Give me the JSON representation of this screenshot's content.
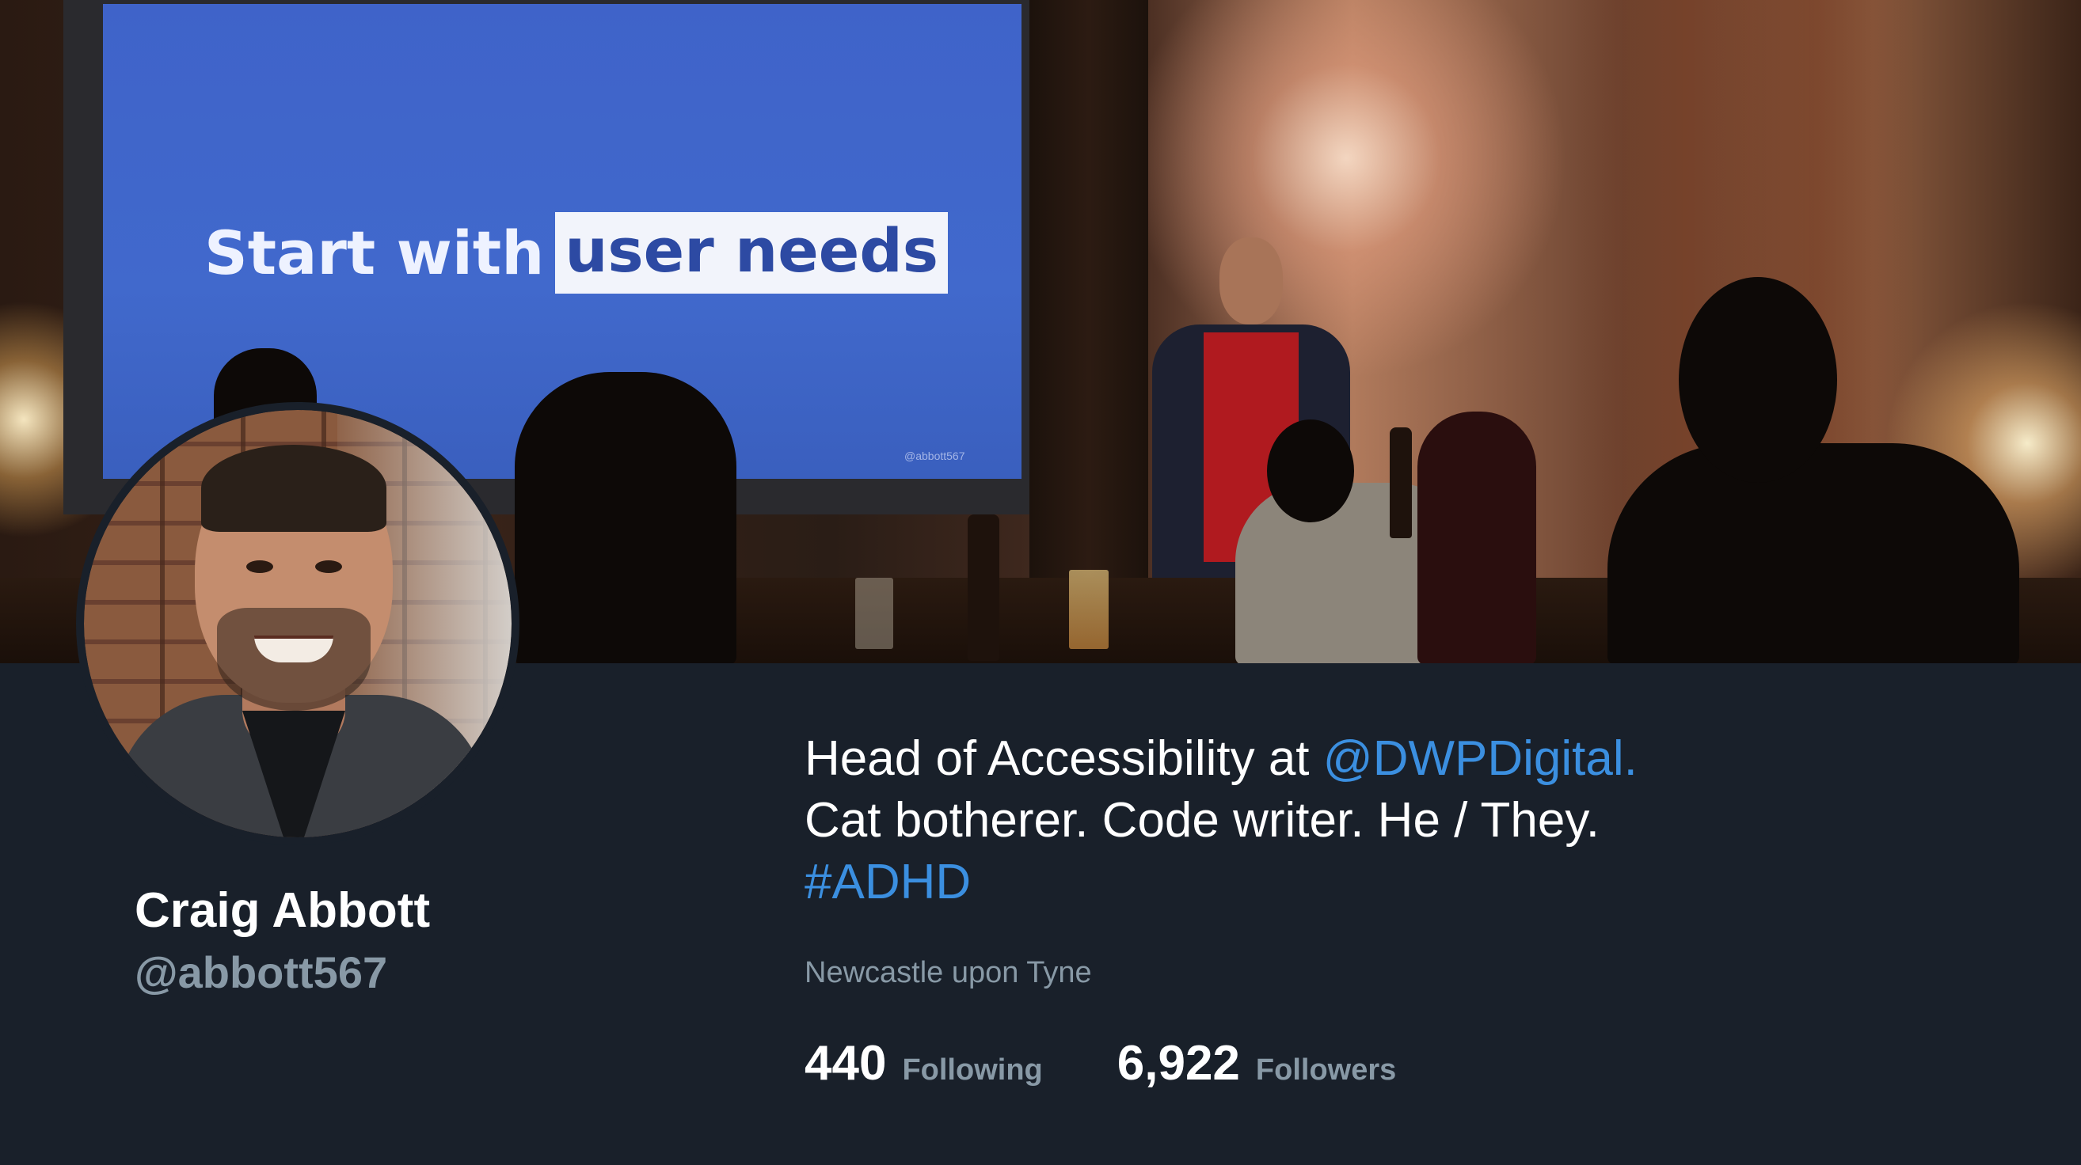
{
  "banner": {
    "slide_text_plain": "Start with",
    "slide_text_highlight": "user needs",
    "slide_credit": "@abbott567"
  },
  "profile": {
    "name": "Craig Abbott",
    "handle": "@abbott567",
    "bio": {
      "line1_prefix": "Head of Accessibility at ",
      "line1_mention": "@DWPDigital",
      "line1_suffix": ".",
      "line2": "Cat botherer. Code writer. He / They.",
      "line3_hashtag": "#ADHD"
    },
    "location": "Newcastle upon Tyne",
    "stats": {
      "following_count": "440",
      "following_label": "Following",
      "followers_count": "6,922",
      "followers_label": "Followers"
    }
  },
  "colors": {
    "background": "#19202a",
    "link": "#3b8fe0",
    "muted_text": "#8899a6",
    "primary_text": "#ffffff"
  }
}
